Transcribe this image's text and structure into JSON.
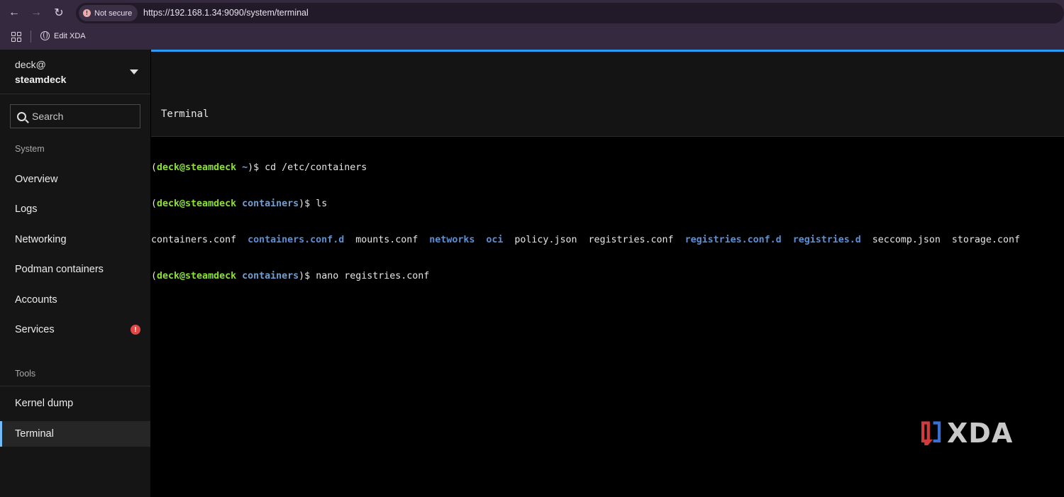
{
  "browser": {
    "security_label": "Not secure",
    "url_scheme": "https",
    "url_rest": "://192.168.1.34:9090/system/terminal",
    "bookmark_label": "Edit XDA"
  },
  "sidebar": {
    "user": "deck@",
    "host": "steamdeck",
    "search_placeholder": "Search",
    "section_system": "System",
    "items": [
      {
        "label": "Overview"
      },
      {
        "label": "Logs"
      },
      {
        "label": "Networking"
      },
      {
        "label": "Podman containers"
      },
      {
        "label": "Accounts"
      },
      {
        "label": "Services",
        "alert": "!"
      }
    ],
    "section_tools": "Tools",
    "tools": [
      {
        "label": "Kernel dump"
      },
      {
        "label": "Terminal"
      }
    ]
  },
  "main": {
    "title": "Terminal"
  },
  "terminal": {
    "lines": [
      {
        "p_open": "(",
        "user": "deck@steamdeck",
        "dir": " ~",
        "p_close": ")$ ",
        "cmd": "cd /etc/containers"
      },
      {
        "p_open": "(",
        "user": "deck@steamdeck",
        "dir": " containers",
        "p_close": ")$ ",
        "cmd": "ls"
      },
      {
        "p_open": "(",
        "user": "deck@steamdeck",
        "dir": " containers",
        "p_close": ")$ ",
        "cmd": "nano registries.conf"
      }
    ],
    "ls_output": [
      {
        "name": "containers.conf",
        "type": "file"
      },
      {
        "name": "containers.conf.d",
        "type": "dir"
      },
      {
        "name": "mounts.conf",
        "type": "file"
      },
      {
        "name": "networks",
        "type": "dir"
      },
      {
        "name": "oci",
        "type": "dir"
      },
      {
        "name": "policy.json",
        "type": "file"
      },
      {
        "name": "registries.conf",
        "type": "file"
      },
      {
        "name": "registries.conf.d",
        "type": "dir"
      },
      {
        "name": "registries.d",
        "type": "dir"
      },
      {
        "name": "seccomp.json",
        "type": "file"
      },
      {
        "name": "storage.conf",
        "type": "file"
      }
    ]
  },
  "watermark": {
    "text": "XDA",
    "colors": {
      "red": "#d23b3b",
      "blue": "#3a6fd1",
      "gray": "#c9c9c9"
    }
  }
}
